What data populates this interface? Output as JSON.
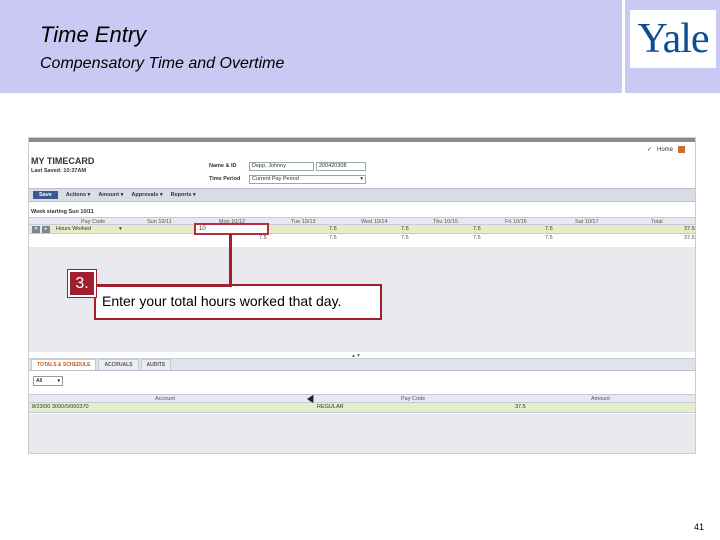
{
  "slide": {
    "title": "Time Entry",
    "subtitle": "Compensatory Time and Overtime",
    "logo_text": "Yale",
    "page_number": "41"
  },
  "colors": {
    "header_bg": "#c9c9f3",
    "logo_blue": "#0f4d92",
    "callout_red": "#a01e2e",
    "row_green": "#e5edc8"
  },
  "app": {
    "home_link": "Home",
    "heading": "MY TIMECARD",
    "last_saved": "Last Saved: 10:37AM",
    "name_label": "Name & ID",
    "name_value": "Depp, Johnny",
    "id_value": "200420308",
    "period_label": "Time Period",
    "period_value": "Current Pay Period",
    "toolbar": {
      "save": "Save",
      "menus": [
        "Actions",
        "Amount",
        "Approvals",
        "Reports"
      ]
    },
    "week_label": "Week starting Sun 10/11",
    "grid": {
      "columns": [
        "Pay Code",
        "Sun 10/11",
        "Mon 10/12",
        "Tue 10/13",
        "Wed 10/14",
        "Thu 10/15",
        "Fri 10/16",
        "Sat 10/17",
        "Total"
      ],
      "row": {
        "pay_code": "Hours Worked",
        "mon_entry": "10",
        "values": [
          "7.5",
          "7.5",
          "7.5",
          "7.5"
        ],
        "total": "37.5"
      },
      "totals": {
        "mon": "7.5",
        "values": [
          "7.5",
          "7.5",
          "7.5",
          "7.5"
        ],
        "total": "37.5"
      }
    },
    "tabs": [
      "TOTALS & SCHEDULE",
      "ACCRUALS",
      "AUDITS"
    ],
    "filter_value": "All",
    "lower": {
      "columns": [
        "Account",
        "Pay Code",
        "Amount"
      ],
      "row": {
        "account": "8/23/00 3000/0/000370",
        "pay_code": "REGULAR",
        "amount": "37.5"
      }
    }
  },
  "callout": {
    "step": "3.",
    "text": "Enter your total hours worked that day."
  }
}
